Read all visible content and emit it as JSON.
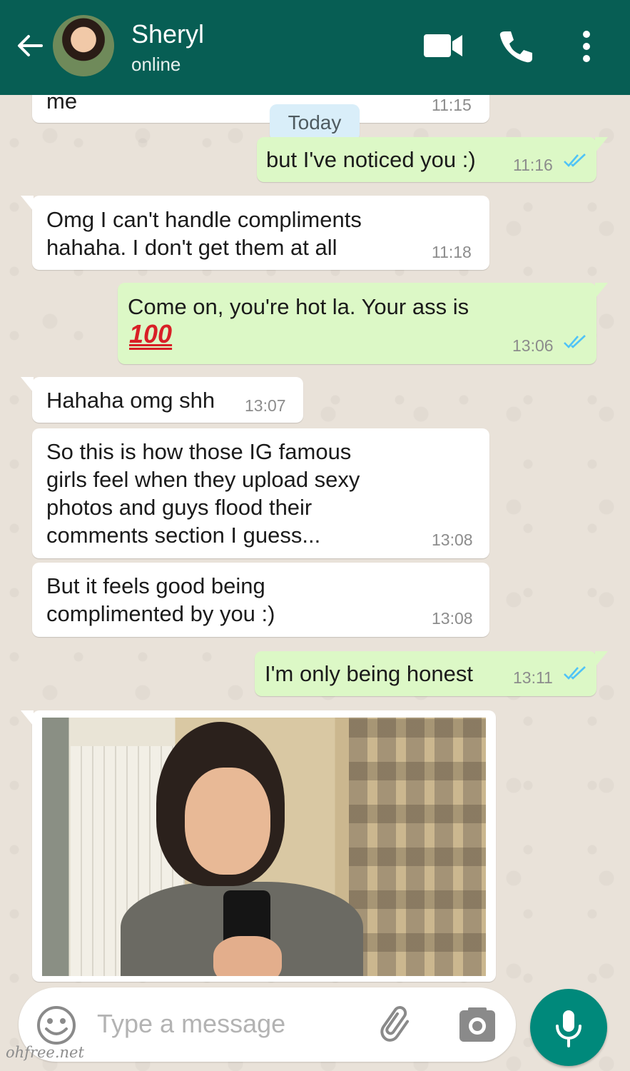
{
  "header": {
    "contact_name": "Sheryl",
    "status": "online",
    "colors": {
      "bar": "#075e54"
    },
    "icons": [
      "back-arrow-icon",
      "video-call-icon",
      "phone-call-icon",
      "more-options-icon"
    ]
  },
  "date_chip": "Today",
  "messages": [
    {
      "direction": "incoming",
      "text": "me",
      "time": "11:15"
    },
    {
      "direction": "outgoing",
      "text": "but I've noticed you :)",
      "time": "11:16",
      "read": true
    },
    {
      "direction": "incoming",
      "text": "Omg I can't handle compliments\nhahaha. I don't get them at all",
      "time": "11:18"
    },
    {
      "direction": "outgoing",
      "text": "Come on, you're hot la. Your ass is",
      "emoji": "100",
      "time": "13:06",
      "read": true
    },
    {
      "direction": "incoming",
      "text": "Hahaha omg shh",
      "time": "13:07"
    },
    {
      "direction": "incoming",
      "text": "So this is how those IG famous\ngirls feel when they upload sexy\nphotos and guys flood their\ncomments section I guess...",
      "time": "13:08"
    },
    {
      "direction": "incoming",
      "text": "But it feels good being\ncomplimented by you :)",
      "time": "13:08"
    },
    {
      "direction": "outgoing",
      "text": "I'm only being honest",
      "time": "13:11",
      "read": true
    },
    {
      "direction": "incoming",
      "type": "photo"
    }
  ],
  "input": {
    "placeholder": "Type a message",
    "icons": [
      "emoji-icon",
      "attach-icon",
      "camera-icon",
      "mic-icon"
    ]
  },
  "watermark": "ohfree.net",
  "colors": {
    "outgoing_bubble": "#dcf8c6",
    "incoming_bubble": "#ffffff",
    "read_ticks": "#4fc3f7",
    "mic_button": "#00897b"
  }
}
